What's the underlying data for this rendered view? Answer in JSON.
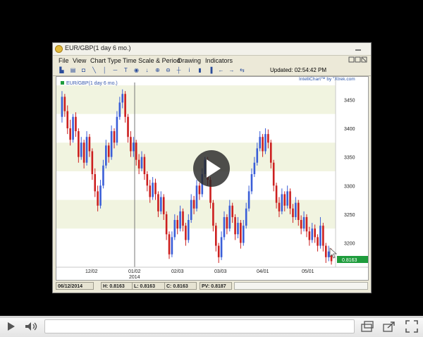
{
  "window": {
    "title": "EUR/GBP(1 day 6 mo.)",
    "controls": "_ □ ×"
  },
  "menu": [
    "File",
    "View",
    "Chart Type",
    "Time Scale & Period",
    "Drawing",
    "Indicators"
  ],
  "toolbar": {
    "icons": [
      "bar-chart-icon",
      "print-icon",
      "save-icon",
      "line-tool-icon",
      "vertical-line-icon",
      "horizontal-line-icon",
      "text-tool-icon",
      "circle-tool-icon",
      "arrow-down-icon",
      "zoom-in-icon",
      "zoom-out-icon",
      "crosshair-icon",
      "info-icon",
      "candles-icon",
      "bar-icon",
      "arrow-left-icon",
      "arrow-right-icon",
      "pan-icon"
    ],
    "updated": "Updated: 02:54:42 PM"
  },
  "chart": {
    "legend": "EUR/GBP(1 day 6 mo.)",
    "brand": "IntelliChart™ by \"Xtrek.com",
    "price_label": "0.8163",
    "colors": {
      "up": "#3a5ed8",
      "down": "#cc1f1f",
      "band": "#f1f4e0",
      "last": "#1e9c3c"
    }
  },
  "chart_data": {
    "type": "candlestick",
    "yticks": [
      "3450",
      "3400",
      "3350",
      "3300",
      "3250",
      "3200"
    ],
    "ylim": [
      3160,
      3480
    ],
    "xticks": [
      "12/02",
      "01/02",
      "02/03",
      "03/03",
      "04/01",
      "05/01"
    ],
    "xyear": "2014",
    "series": [
      {
        "open": 3420,
        "close": 3455,
        "high": 3465,
        "low": 3410
      },
      {
        "open": 3455,
        "close": 3430,
        "high": 3460,
        "low": 3420
      },
      {
        "open": 3430,
        "close": 3400,
        "high": 3440,
        "low": 3390
      },
      {
        "open": 3400,
        "close": 3380,
        "high": 3415,
        "low": 3370
      },
      {
        "open": 3380,
        "close": 3420,
        "high": 3425,
        "low": 3375
      },
      {
        "open": 3420,
        "close": 3395,
        "high": 3428,
        "low": 3385
      },
      {
        "open": 3395,
        "close": 3350,
        "high": 3400,
        "low": 3340
      },
      {
        "open": 3350,
        "close": 3375,
        "high": 3385,
        "low": 3345
      },
      {
        "open": 3375,
        "close": 3340,
        "high": 3380,
        "low": 3330
      },
      {
        "open": 3340,
        "close": 3385,
        "high": 3395,
        "low": 3335
      },
      {
        "open": 3385,
        "close": 3360,
        "high": 3390,
        "low": 3350
      },
      {
        "open": 3360,
        "close": 3320,
        "high": 3365,
        "low": 3310
      },
      {
        "open": 3320,
        "close": 3290,
        "high": 3330,
        "low": 3280
      },
      {
        "open": 3290,
        "close": 3265,
        "high": 3300,
        "low": 3255
      },
      {
        "open": 3265,
        "close": 3300,
        "high": 3310,
        "low": 3260
      },
      {
        "open": 3300,
        "close": 3335,
        "high": 3345,
        "low": 3295
      },
      {
        "open": 3335,
        "close": 3370,
        "high": 3380,
        "low": 3330
      },
      {
        "open": 3370,
        "close": 3350,
        "high": 3375,
        "low": 3340
      },
      {
        "open": 3350,
        "close": 3395,
        "high": 3405,
        "low": 3345
      },
      {
        "open": 3395,
        "close": 3375,
        "high": 3400,
        "low": 3365
      },
      {
        "open": 3375,
        "close": 3420,
        "high": 3430,
        "low": 3370
      },
      {
        "open": 3420,
        "close": 3445,
        "high": 3455,
        "low": 3415
      },
      {
        "open": 3445,
        "close": 3460,
        "high": 3468,
        "low": 3435
      },
      {
        "open": 3460,
        "close": 3420,
        "high": 3465,
        "low": 3410
      },
      {
        "open": 3420,
        "close": 3385,
        "high": 3425,
        "low": 3375
      },
      {
        "open": 3385,
        "close": 3360,
        "high": 3395,
        "low": 3350
      },
      {
        "open": 3360,
        "close": 3375,
        "high": 3385,
        "low": 3350
      },
      {
        "open": 3375,
        "close": 3345,
        "high": 3380,
        "low": 3335
      },
      {
        "open": 3345,
        "close": 3330,
        "high": 3355,
        "low": 3320
      },
      {
        "open": 3330,
        "close": 3350,
        "high": 3360,
        "low": 3325
      },
      {
        "open": 3350,
        "close": 3320,
        "high": 3355,
        "low": 3310
      },
      {
        "open": 3320,
        "close": 3300,
        "high": 3325,
        "low": 3290
      },
      {
        "open": 3300,
        "close": 3280,
        "high": 3310,
        "low": 3270
      },
      {
        "open": 3280,
        "close": 3305,
        "high": 3315,
        "low": 3275
      },
      {
        "open": 3305,
        "close": 3285,
        "high": 3312,
        "low": 3275
      },
      {
        "open": 3285,
        "close": 3255,
        "high": 3290,
        "low": 3245
      },
      {
        "open": 3255,
        "close": 3280,
        "high": 3290,
        "low": 3250
      },
      {
        "open": 3280,
        "close": 3250,
        "high": 3285,
        "low": 3240
      },
      {
        "open": 3250,
        "close": 3215,
        "high": 3255,
        "low": 3205
      },
      {
        "open": 3215,
        "close": 3180,
        "high": 3220,
        "low": 3172
      },
      {
        "open": 3180,
        "close": 3210,
        "high": 3220,
        "low": 3175
      },
      {
        "open": 3210,
        "close": 3240,
        "high": 3250,
        "low": 3205
      },
      {
        "open": 3240,
        "close": 3225,
        "high": 3248,
        "low": 3215
      },
      {
        "open": 3225,
        "close": 3255,
        "high": 3265,
        "low": 3220
      },
      {
        "open": 3255,
        "close": 3230,
        "high": 3260,
        "low": 3220
      },
      {
        "open": 3230,
        "close": 3205,
        "high": 3235,
        "low": 3195
      },
      {
        "open": 3205,
        "close": 3240,
        "high": 3250,
        "low": 3200
      },
      {
        "open": 3240,
        "close": 3275,
        "high": 3285,
        "low": 3235
      },
      {
        "open": 3275,
        "close": 3260,
        "high": 3282,
        "low": 3250
      },
      {
        "open": 3260,
        "close": 3300,
        "high": 3310,
        "low": 3255
      },
      {
        "open": 3300,
        "close": 3285,
        "high": 3305,
        "low": 3275
      },
      {
        "open": 3285,
        "close": 3320,
        "high": 3330,
        "low": 3280
      },
      {
        "open": 3320,
        "close": 3345,
        "high": 3350,
        "low": 3315
      },
      {
        "open": 3345,
        "close": 3310,
        "high": 3350,
        "low": 3300
      },
      {
        "open": 3310,
        "close": 3270,
        "high": 3315,
        "low": 3260
      },
      {
        "open": 3270,
        "close": 3230,
        "high": 3275,
        "low": 3220
      },
      {
        "open": 3230,
        "close": 3195,
        "high": 3235,
        "low": 3185
      },
      {
        "open": 3195,
        "close": 3175,
        "high": 3200,
        "low": 3165
      },
      {
        "open": 3175,
        "close": 3210,
        "high": 3220,
        "low": 3170
      },
      {
        "open": 3210,
        "close": 3245,
        "high": 3255,
        "low": 3205
      },
      {
        "open": 3245,
        "close": 3225,
        "high": 3250,
        "low": 3215
      },
      {
        "open": 3225,
        "close": 3265,
        "high": 3275,
        "low": 3220
      },
      {
        "open": 3265,
        "close": 3245,
        "high": 3270,
        "low": 3235
      },
      {
        "open": 3245,
        "close": 3215,
        "high": 3250,
        "low": 3205
      },
      {
        "open": 3215,
        "close": 3235,
        "high": 3245,
        "low": 3208
      },
      {
        "open": 3235,
        "close": 3200,
        "high": 3240,
        "low": 3190
      },
      {
        "open": 3200,
        "close": 3230,
        "high": 3240,
        "low": 3195
      },
      {
        "open": 3230,
        "close": 3260,
        "high": 3270,
        "low": 3225
      },
      {
        "open": 3260,
        "close": 3290,
        "high": 3300,
        "low": 3255
      },
      {
        "open": 3290,
        "close": 3320,
        "high": 3330,
        "low": 3285
      },
      {
        "open": 3320,
        "close": 3340,
        "high": 3350,
        "low": 3315
      },
      {
        "open": 3340,
        "close": 3365,
        "high": 3375,
        "low": 3335
      },
      {
        "open": 3365,
        "close": 3385,
        "high": 3395,
        "low": 3360
      },
      {
        "open": 3385,
        "close": 3360,
        "high": 3390,
        "low": 3350
      },
      {
        "open": 3360,
        "close": 3390,
        "high": 3400,
        "low": 3355
      },
      {
        "open": 3390,
        "close": 3375,
        "high": 3398,
        "low": 3365
      },
      {
        "open": 3375,
        "close": 3340,
        "high": 3380,
        "low": 3330
      },
      {
        "open": 3340,
        "close": 3300,
        "high": 3345,
        "low": 3290
      },
      {
        "open": 3300,
        "close": 3270,
        "high": 3305,
        "low": 3260
      },
      {
        "open": 3270,
        "close": 3255,
        "high": 3280,
        "low": 3245
      },
      {
        "open": 3255,
        "close": 3285,
        "high": 3295,
        "low": 3250
      },
      {
        "open": 3285,
        "close": 3265,
        "high": 3290,
        "low": 3255
      },
      {
        "open": 3265,
        "close": 3290,
        "high": 3300,
        "low": 3260
      },
      {
        "open": 3290,
        "close": 3260,
        "high": 3295,
        "low": 3250
      },
      {
        "open": 3260,
        "close": 3245,
        "high": 3268,
        "low": 3235
      },
      {
        "open": 3245,
        "close": 3270,
        "high": 3280,
        "low": 3240
      },
      {
        "open": 3270,
        "close": 3240,
        "high": 3275,
        "low": 3230
      },
      {
        "open": 3240,
        "close": 3225,
        "high": 3248,
        "low": 3215
      },
      {
        "open": 3225,
        "close": 3245,
        "high": 3255,
        "low": 3220
      },
      {
        "open": 3245,
        "close": 3220,
        "high": 3250,
        "low": 3210
      },
      {
        "open": 3220,
        "close": 3205,
        "high": 3228,
        "low": 3195
      },
      {
        "open": 3205,
        "close": 3225,
        "high": 3235,
        "low": 3200
      },
      {
        "open": 3225,
        "close": 3210,
        "high": 3232,
        "low": 3200
      },
      {
        "open": 3210,
        "close": 3195,
        "high": 3215,
        "low": 3185
      },
      {
        "open": 3195,
        "close": 3230,
        "high": 3245,
        "low": 3190
      },
      {
        "open": 3230,
        "close": 3195,
        "high": 3235,
        "low": 3185
      },
      {
        "open": 3195,
        "close": 3175,
        "high": 3200,
        "low": 3165
      },
      {
        "open": 3175,
        "close": 3185,
        "high": 3195,
        "low": 3168
      },
      {
        "open": 3185,
        "close": 3168,
        "high": 3190,
        "low": 3162
      }
    ]
  },
  "status": {
    "date": "06/12/2014",
    "high": "H: 0.8163",
    "low": "L: 0.8163",
    "close": "C: 0.8163",
    "pv": "PV: 0.8187"
  },
  "video": {
    "progress": 0.0
  }
}
